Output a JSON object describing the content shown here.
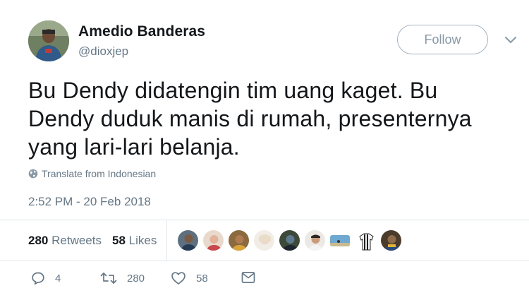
{
  "author": {
    "display_name": "Amedio Banderas",
    "username": "@dioxjep",
    "avatar_icon": "user-avatar"
  },
  "follow_label": "Follow",
  "tweet": {
    "text": "Bu Dendy didatengin tim uang kaget. Bu\nDendy duduk manis di  rumah, presenternya\nyang lari-lari belanja.",
    "translate_label": "Translate from Indonesian",
    "timestamp": "2:52 PM - 20 Feb 2018"
  },
  "stats": {
    "retweets_count": "280",
    "retweets_label": "Retweets",
    "likes_count": "58",
    "likes_label": "Likes"
  },
  "liker_faces": [
    "face-1",
    "face-2",
    "face-3",
    "face-4",
    "face-5",
    "face-6",
    "face-7",
    "face-8",
    "face-9"
  ],
  "actions": {
    "reply_count": "4",
    "retweet_count": "280",
    "like_count": "58"
  },
  "colors": {
    "text": "#14171a",
    "secondary": "#657786",
    "border": "#e1e8ed",
    "follow_border": "#a5b3bf"
  }
}
